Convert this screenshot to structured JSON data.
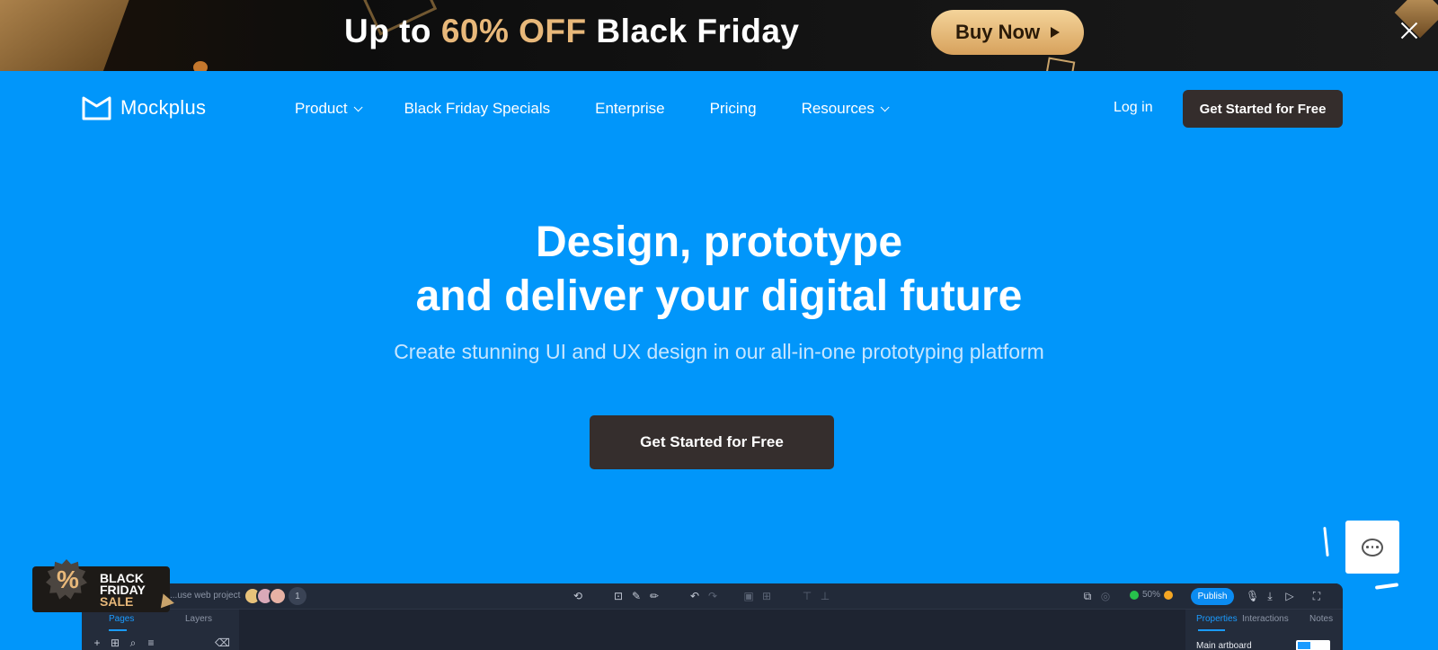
{
  "promo": {
    "text_prefix": "Up to ",
    "text_highlight": "60% OFF",
    "text_suffix": " Black Friday",
    "buy_label": "Buy Now",
    "accent_color": "#e8b87a"
  },
  "nav": {
    "logo_text": "Mockplus",
    "links": [
      {
        "label": "Product",
        "has_dropdown": true
      },
      {
        "label": "Black Friday Specials",
        "has_dropdown": false
      },
      {
        "label": "Enterprise",
        "has_dropdown": false
      },
      {
        "label": "Pricing",
        "has_dropdown": false
      },
      {
        "label": "Resources",
        "has_dropdown": true
      }
    ],
    "login_label": "Log in",
    "cta_label": "Get Started for Free"
  },
  "hero": {
    "title_line1": "Design, prototype",
    "title_line2": "and deliver your digital future",
    "subtitle": "Create stunning UI and UX design in our all-in-one prototyping platform",
    "cta_label": "Get Started for Free",
    "background_color": "#0196fa"
  },
  "badge": {
    "symbol": "%",
    "line1": "BLACK",
    "line2": "FRIDAY",
    "line3": "SALE"
  },
  "editor": {
    "project_name": "...use web project",
    "collaborator_count": "1",
    "zoom": "50%",
    "publish_label": "Publish",
    "left_tabs": [
      "Pages",
      "Layers"
    ],
    "right_tabs": [
      "Properties",
      "Interactions",
      "Notes"
    ],
    "artboard_label": "Main artboard"
  }
}
